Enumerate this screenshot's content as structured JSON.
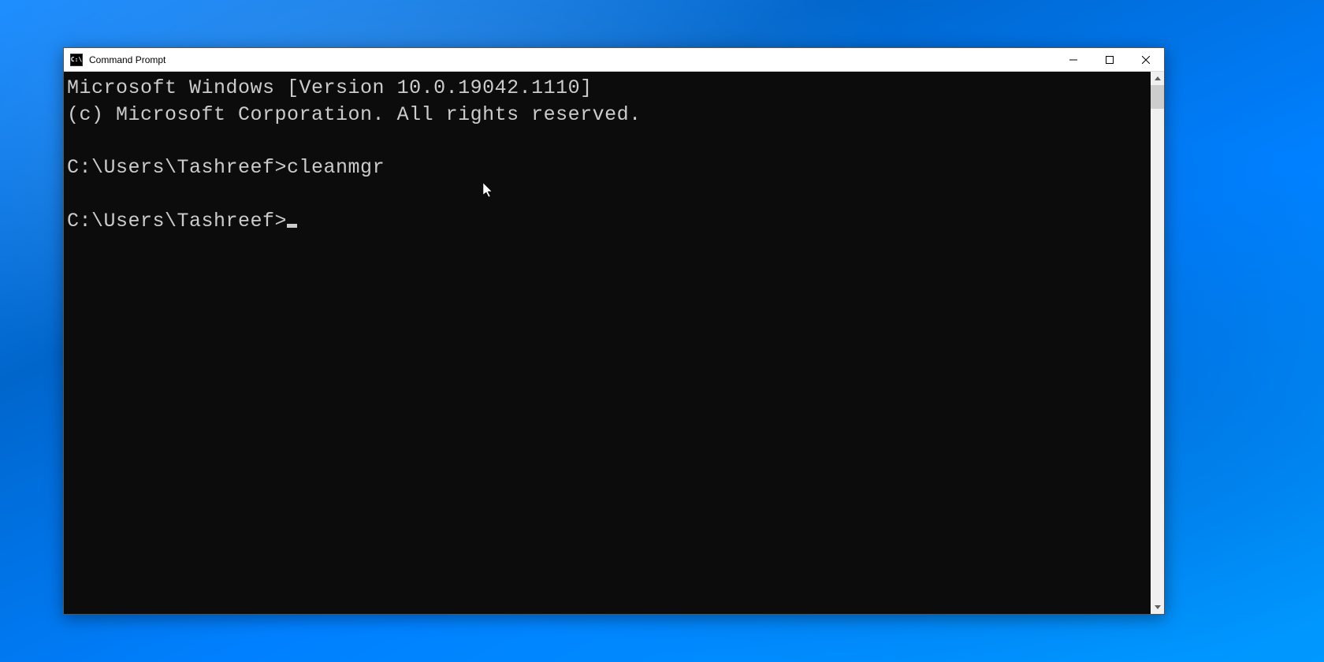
{
  "window": {
    "title": "Command Prompt"
  },
  "terminal": {
    "line1": "Microsoft Windows [Version 10.0.19042.1110]",
    "line2": "(c) Microsoft Corporation. All rights reserved.",
    "blank1": "",
    "prompt1_path": "C:\\Users\\Tashreef>",
    "prompt1_cmd": "cleanmgr",
    "blank2": "",
    "prompt2_path": "C:\\Users\\Tashreef>"
  }
}
